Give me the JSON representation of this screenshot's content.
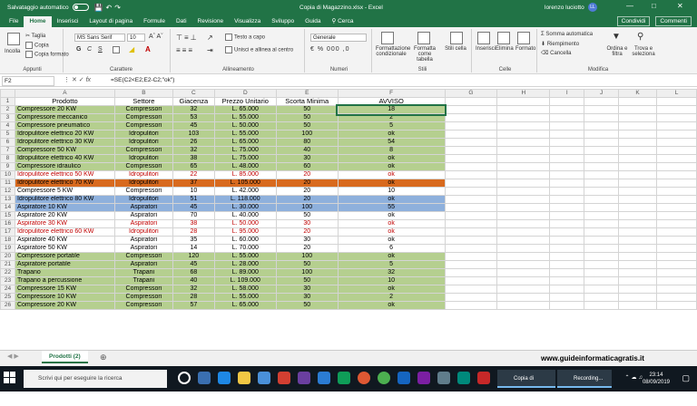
{
  "titlebar": {
    "autosave_label": "Salvataggio automatico",
    "toggle_state": "No",
    "document_title": "Copia di Magazzino.xlsx  -  Excel",
    "user_name": "lorenzo luciotto",
    "user_initials": "LL"
  },
  "tabs": [
    "File",
    "Home",
    "Inserisci",
    "Layout di pagina",
    "Formule",
    "Dati",
    "Revisione",
    "Visualizza",
    "Sviluppo",
    "Guida"
  ],
  "tab_active": "Home",
  "tell_me": "Cerca",
  "share": "Condividi",
  "comments": "Commenti",
  "ribbon": {
    "clipboard": {
      "label": "Appunti",
      "paste": "Incolla",
      "cut": "Taglia",
      "copy": "Copia",
      "format_painter": "Copia formato"
    },
    "font": {
      "label": "Carattere",
      "family": "MS Sans Serif",
      "size": "10"
    },
    "alignment": {
      "label": "Allineamento",
      "wrap": "Testo a capo",
      "merge": "Unisci e allinea al centro"
    },
    "number": {
      "label": "Numeri",
      "format": "Generale"
    },
    "styles": {
      "label": "Stili",
      "conditional": "Formattazione condizionale",
      "table": "Formatta come tabella",
      "cell_styles": "Stili cella"
    },
    "cells": {
      "label": "Celle",
      "insert": "Inserisci",
      "delete": "Elimina",
      "format": "Formato"
    },
    "editing": {
      "label": "Modifica",
      "autosum": "Somma automatica",
      "fill": "Riempimento",
      "clear": "Cancella",
      "sort": "Ordina e filtra",
      "find": "Trova e seleziona"
    }
  },
  "formula_bar": {
    "name_box": "F2",
    "formula": "=SE(C2<E2;E2-C2;\"ok\")"
  },
  "columns": [
    "A",
    "B",
    "C",
    "D",
    "E",
    "F",
    "G",
    "H",
    "I",
    "J",
    "K",
    "L"
  ],
  "headers": [
    "Prodotto",
    "Settore",
    "Giacenza",
    "Prezzo Unitario",
    "Scorta Minima",
    "AVVISO"
  ],
  "rows": [
    {
      "n": "2",
      "cells": [
        "Compressore 20 KW",
        "Compressori",
        "32",
        "L. 65.000",
        "50",
        "18"
      ],
      "fill": "#b5cf8f",
      "font": "#000",
      "sel": true
    },
    {
      "n": "3",
      "cells": [
        "Compressore meccanico",
        "Compressori",
        "53",
        "L. 55.000",
        "50",
        "2"
      ],
      "fill": "#b5cf8f",
      "font": "#000"
    },
    {
      "n": "4",
      "cells": [
        "Compressore pneumatico",
        "Compressori",
        "45",
        "L. 50.000",
        "50",
        "5"
      ],
      "fill": "#b5cf8f",
      "font": "#000"
    },
    {
      "n": "5",
      "cells": [
        "Idropulitore elettrico 20 KW",
        "Idropulitori",
        "103",
        "L. 55.000",
        "100",
        "ok"
      ],
      "fill": "#b5cf8f",
      "font": "#000"
    },
    {
      "n": "6",
      "cells": [
        "Idropulitore elettrico 30 KW",
        "Idropulitori",
        "26",
        "L. 65.000",
        "80",
        "54"
      ],
      "fill": "#b5cf8f",
      "font": "#000"
    },
    {
      "n": "7",
      "cells": [
        "Compressore 50 KW",
        "Compressori",
        "32",
        "L. 75.000",
        "40",
        "8"
      ],
      "fill": "#b5cf8f",
      "font": "#000"
    },
    {
      "n": "8",
      "cells": [
        "Idropulitore elettrico 40 KW",
        "Idropulitori",
        "38",
        "L. 75.000",
        "30",
        "ok"
      ],
      "fill": "#b5cf8f",
      "font": "#000"
    },
    {
      "n": "9",
      "cells": [
        "Compressore idraulico",
        "Compressori",
        "65",
        "L. 48.000",
        "60",
        "ok"
      ],
      "fill": "#b5cf8f",
      "font": "#000"
    },
    {
      "n": "10",
      "cells": [
        "Idropulitore elettrico 50 KW",
        "Idropulitori",
        "22",
        "L. 85.000",
        "20",
        "ok"
      ],
      "fill": "#ffffff",
      "font": "#c00000"
    },
    {
      "n": "11",
      "cells": [
        "Idropulitore elettrico 70 KW",
        "Idropulitori",
        "37",
        "L. 105.000",
        "20",
        "ok"
      ],
      "fill": "#d86a1e",
      "font": "#000"
    },
    {
      "n": "12",
      "cells": [
        "Compressore 5 KW",
        "Compressori",
        "10",
        "L. 42.000",
        "20",
        "10"
      ],
      "fill": "#ffffff",
      "font": "#000"
    },
    {
      "n": "13",
      "cells": [
        "Idropulitore elettrico 80 KW",
        "Idropulitori",
        "51",
        "L. 118.000",
        "20",
        "ok"
      ],
      "fill": "#8eb0dc",
      "font": "#000"
    },
    {
      "n": "14",
      "cells": [
        "Aspiratore 10 KW",
        "Aspiratori",
        "45",
        "L. 30.000",
        "100",
        "55"
      ],
      "fill": "#8eb0dc",
      "font": "#000"
    },
    {
      "n": "15",
      "cells": [
        "Aspiratore 20 KW",
        "Aspiratori",
        "70",
        "L. 40.000",
        "50",
        "ok"
      ],
      "fill": "#ffffff",
      "font": "#000"
    },
    {
      "n": "16",
      "cells": [
        "Aspiratore 30 KW",
        "Aspiratori",
        "38",
        "L. 50.000",
        "30",
        "ok"
      ],
      "fill": "#ffffff",
      "font": "#c00000"
    },
    {
      "n": "17",
      "cells": [
        "Idropulitore elettrico 60 KW",
        "Idropulitori",
        "28",
        "L. 95.000",
        "20",
        "ok"
      ],
      "fill": "#ffffff",
      "font": "#c00000"
    },
    {
      "n": "18",
      "cells": [
        "Aspiratore 40 KW",
        "Aspiratori",
        "35",
        "L. 60.000",
        "30",
        "ok"
      ],
      "fill": "#ffffff",
      "font": "#000"
    },
    {
      "n": "19",
      "cells": [
        "Aspiratore 50 KW",
        "Aspiratori",
        "14",
        "L. 70.000",
        "20",
        "6"
      ],
      "fill": "#ffffff",
      "font": "#000"
    },
    {
      "n": "20",
      "cells": [
        "Compressore portatile",
        "Compressori",
        "120",
        "L. 55.000",
        "100",
        "ok"
      ],
      "fill": "#b5cf8f",
      "font": "#000"
    },
    {
      "n": "21",
      "cells": [
        "Aspiratore portatile",
        "Aspiratori",
        "45",
        "L. 28.000",
        "50",
        "5"
      ],
      "fill": "#b5cf8f",
      "font": "#000"
    },
    {
      "n": "22",
      "cells": [
        "Trapano",
        "Trapani",
        "68",
        "L. 89.000",
        "100",
        "32"
      ],
      "fill": "#b5cf8f",
      "font": "#000"
    },
    {
      "n": "23",
      "cells": [
        "Trapano a percussione",
        "Trapani",
        "40",
        "L. 109.000",
        "50",
        "10"
      ],
      "fill": "#b5cf8f",
      "font": "#000"
    },
    {
      "n": "24",
      "cells": [
        "Compressore 15 KW",
        "Compressori",
        "32",
        "L. 58.000",
        "30",
        "ok"
      ],
      "fill": "#b5cf8f",
      "font": "#000"
    },
    {
      "n": "25",
      "cells": [
        "Compressore 10 KW",
        "Compressori",
        "28",
        "L. 55.000",
        "30",
        "2"
      ],
      "fill": "#b5cf8f",
      "font": "#000"
    },
    {
      "n": "26",
      "cells": [
        "Compressore 20 KW",
        "Compressori",
        "57",
        "L. 65.000",
        "50",
        "ok"
      ],
      "fill": "#b5cf8f",
      "font": "#000"
    }
  ],
  "sheet_tab": "Prodotti (2)",
  "watermark": "www.guideinformaticagratis.it",
  "taskbar": {
    "search_placeholder": "Scrivi qui per eseguire la ricerca",
    "excel_task": "Copia di Magaz...",
    "recording_task": "Recording...",
    "time": "23:14",
    "date": "08/09/2019"
  }
}
